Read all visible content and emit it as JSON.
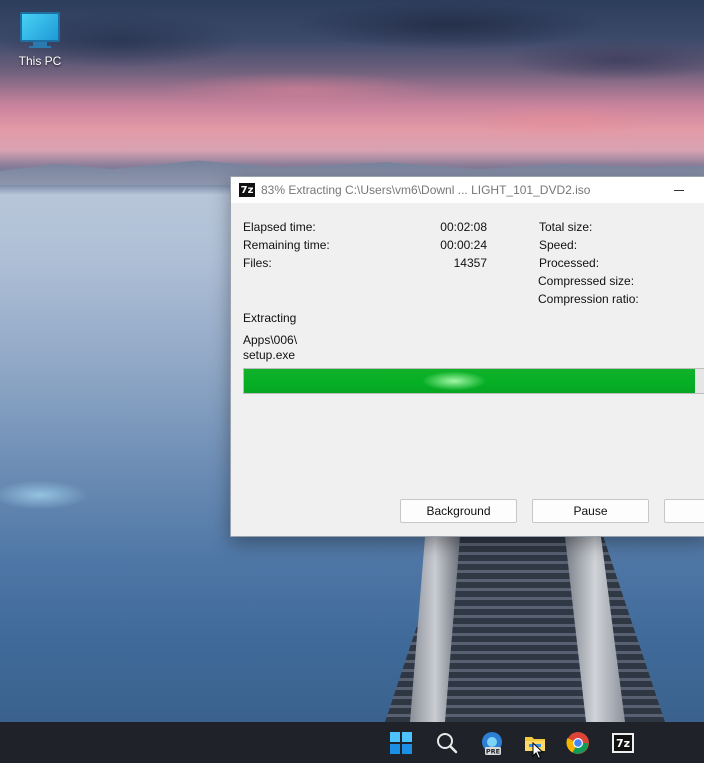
{
  "desktop": {
    "icon_label": "This PC"
  },
  "window": {
    "app_icon_text": "7z",
    "title": "83% Extracting C:\\Users\\vm6\\Downl ... LIGHT_101_DVD2.iso",
    "progress_percent": 83,
    "stats_left": [
      {
        "label": "Elapsed time:",
        "value": "00:02:08"
      },
      {
        "label": "Remaining time:",
        "value": "00:00:24"
      },
      {
        "label": "Files:",
        "value": "14357"
      }
    ],
    "stats_right": [
      {
        "label": "Total size:"
      },
      {
        "label": "Speed:"
      },
      {
        "label": "Processed:"
      },
      {
        "label": "Compressed size:"
      },
      {
        "label": "Compression ratio:"
      }
    ],
    "operation": "Extracting",
    "current_path": "Apps\\006\\",
    "current_file": "setup.exe",
    "buttons": {
      "background": "Background",
      "pause": "Pause"
    }
  },
  "taskbar": {
    "items": [
      "start-icon",
      "search-icon",
      "edge-pre-icon",
      "file-explorer-icon",
      "chrome-icon",
      "sevenzip-icon"
    ],
    "edge_badge": "PRE",
    "sevenzip_text": "7z"
  },
  "colors": {
    "progress": "#06b025",
    "taskbar": "#1f2228",
    "accent": "#0078d4"
  }
}
